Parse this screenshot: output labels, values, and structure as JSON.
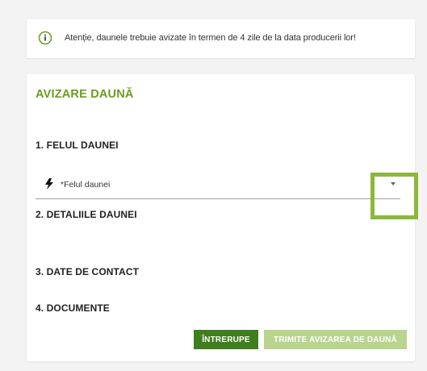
{
  "notice": {
    "icon": "info-circle-icon",
    "text": "Atenție, daunele trebuie avizate în termen de 4 zile de la data producerii lor!"
  },
  "form": {
    "title": "AVIZARE DAUNĂ",
    "sections": [
      {
        "label": "1. FELUL DAUNEI"
      },
      {
        "label": "2. DETALIILE DAUNEI"
      },
      {
        "label": "3. DATE DE CONTACT"
      },
      {
        "label": "4. DOCUMENTE"
      }
    ],
    "damage_type_field": {
      "icon": "lightning-bolt-icon",
      "placeholder": "*Felul daunei",
      "value": ""
    },
    "buttons": {
      "interrupt_label": "ÎNTRERUPE",
      "submit_label": "TRIMITE AVIZAREA DE DAUNĂ"
    }
  },
  "colors": {
    "accent_green": "#6a9d1f",
    "button_dark_green": "#3f7d1e",
    "button_disabled_green": "#b8d48e",
    "highlight_green": "#8cb83a"
  }
}
